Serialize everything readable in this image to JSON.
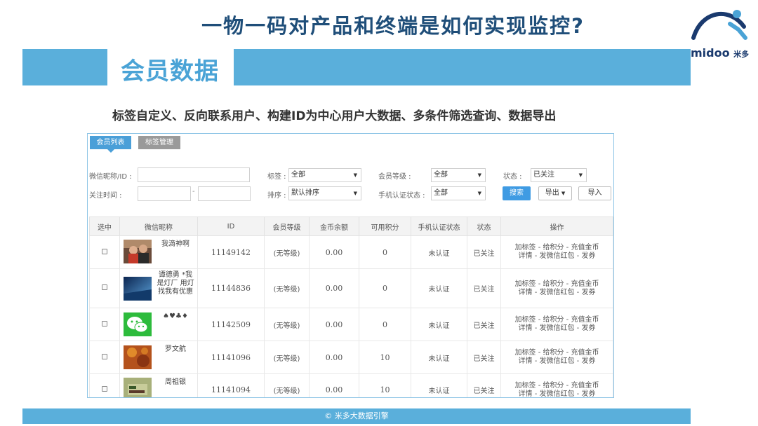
{
  "slide": {
    "title": "一物一码对产品和终端是如何实现监控?",
    "section_label": "会员数据",
    "subtitle": "标签自定义、反向联系用户、构建ID为中心用户大数据、多条件筛选查询、数据导出",
    "footer": "© 米多大数据引擎",
    "logo_text": "midoo",
    "logo_suffix": "米多"
  },
  "tabs": [
    {
      "label": "会员列表",
      "active": true
    },
    {
      "label": "标签管理",
      "active": false
    }
  ],
  "filters": {
    "nickname_label": "微信昵称/ID :",
    "follow_time_label": "关注时间 :",
    "range_separator": "-",
    "tag_label": "标签 :",
    "tag_value": "全部",
    "sort_label": "排序 :",
    "sort_value": "默认排序",
    "level_label": "会员等级 :",
    "level_value": "全部",
    "phone_auth_label": "手机认证状态 :",
    "phone_auth_value": "全部",
    "status_label": "状态 :",
    "status_value": "已关注",
    "search_button": "搜索",
    "export_button": "导出",
    "import_button": "导入"
  },
  "table": {
    "columns": [
      "选中",
      "微信昵称",
      "ID",
      "会员等级",
      "金币余额",
      "可用积分",
      "手机认证状态",
      "状态",
      "操作"
    ],
    "rows": [
      {
        "nickname": "我滴神啊",
        "id": "11149142",
        "level": "(无等级)",
        "coins": "0.00",
        "points": "0",
        "phone_auth": "未认证",
        "status": "已关注",
        "avatar": "photo-people"
      },
      {
        "nickname": "谭德勇 *我是灯厂 用灯找我有优惠",
        "id": "11144836",
        "level": "(无等级)",
        "coins": "0.00",
        "points": "0",
        "phone_auth": "未认证",
        "status": "已关注",
        "avatar": "photo-sky"
      },
      {
        "nickname": "♠♥♣♦",
        "id": "11142509",
        "level": "(无等级)",
        "coins": "0.00",
        "points": "0",
        "phone_auth": "未认证",
        "status": "已关注",
        "avatar": "wechat-logo"
      },
      {
        "nickname": "罗文航",
        "id": "11141096",
        "level": "(无等级)",
        "coins": "0.00",
        "points": "10",
        "phone_auth": "未认证",
        "status": "已关注",
        "avatar": "photo-autumn"
      },
      {
        "nickname": "周祖银",
        "id": "11141094",
        "level": "(无等级)",
        "coins": "0.00",
        "points": "10",
        "phone_auth": "未认证",
        "status": "已关注",
        "avatar": "photo-sign"
      }
    ],
    "ops_line1": "加标签 - 给积分 - 充值金币",
    "ops_line2": "详情 - 发微信红包 - 发券"
  },
  "colors": {
    "banner": "#5aafdb",
    "title": "#1f4e79",
    "section_label": "#4aa3d6",
    "link": "#4aa3e3",
    "primary_button": "#3f9be3"
  }
}
